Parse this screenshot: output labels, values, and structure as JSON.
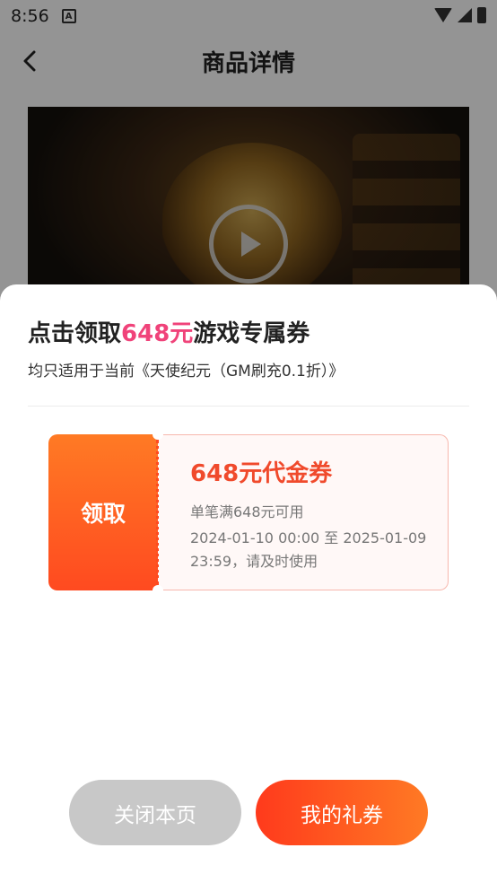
{
  "status_bar": {
    "time": "8:56",
    "notification_glyph": "A",
    "icons": [
      "wifi-icon",
      "signal-icon",
      "battery-icon"
    ]
  },
  "nav": {
    "back_icon": "chevron-left-icon",
    "title": "商品详情"
  },
  "media": {
    "play_icon": "play-icon"
  },
  "sheet": {
    "title_prefix": "点击领取",
    "title_amount": "648元",
    "title_suffix": "游戏专属券",
    "subtitle": "均只适用于当前《天使纪元（GM刷充0.1折）》",
    "coupon": {
      "claim_label": "领取",
      "name": "648元代金券",
      "condition": "单笔满648元可用",
      "validity": "2024-01-10 00:00 至 2025-01-09 23:59，请及时使用"
    },
    "buttons": {
      "close_label": "关闭本页",
      "my_coupons_label": "我的礼券"
    }
  },
  "colors": {
    "accent_pink": "#f0437a",
    "coupon_orange": "#ff4a20",
    "coupon_text_red": "#f04a2c",
    "close_button_gray": "#c8c8c8"
  }
}
